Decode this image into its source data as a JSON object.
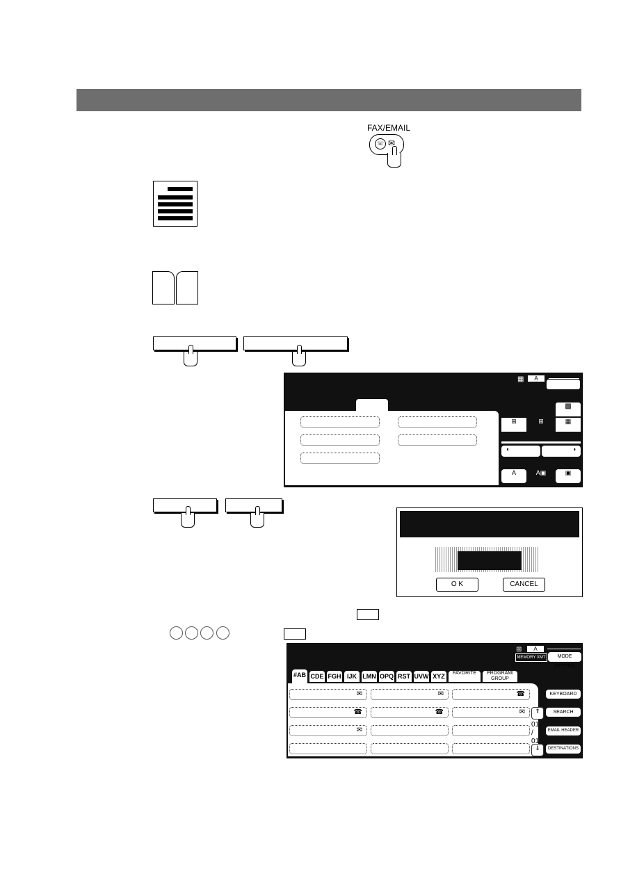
{
  "header": {
    "bar_color": "#6e6e6e"
  },
  "fax_email_key": {
    "label": "FAX/EMAIL",
    "icons": [
      "fax-icon",
      "envelope-icon",
      "hand-pointer-icon"
    ]
  },
  "illustrations": [
    "document-icon",
    "book-icon"
  ],
  "panel1": {
    "tabs": [
      "",
      "",
      "",
      "",
      "",
      ""
    ],
    "active_tab_index": 2,
    "resolution_icons": [
      "standard-grid-icon",
      "fine-grid-icon",
      "superfine-grid-icon"
    ],
    "contrast_icons": [
      "lighter-icon",
      "darker-icon"
    ],
    "original_icons": [
      "text-icon",
      "text-photo-icon",
      "photo-icon"
    ]
  },
  "dialog": {
    "ok_label": "O K",
    "cancel_label": "CANCEL"
  },
  "panel2": {
    "memory_xmt_label": "MEMORY XMT",
    "mode_setting_label": "MODE SETTING",
    "tabs": [
      "#AB",
      "CDE",
      "FGH",
      "IJK",
      "LMN",
      "OPQ",
      "RST",
      "UVW",
      "XYZ",
      "FAVORITE",
      "PROGRAM/ GROUP"
    ],
    "active_tab_index": 0,
    "entries": [
      {
        "icon": "envelope-icon"
      },
      {
        "icon": "envelope-icon"
      },
      {
        "icon": "telephone-icon"
      },
      {
        "icon": "telephone-icon"
      },
      {
        "icon": "telephone-icon"
      },
      {
        "icon": "envelope-icon"
      },
      {
        "icon": "envelope-icon"
      },
      {
        "icon": ""
      },
      {
        "icon": ""
      },
      {
        "icon": ""
      },
      {
        "icon": ""
      },
      {
        "icon": ""
      }
    ],
    "page_current": "01",
    "page_total": "01",
    "side_buttons": [
      "KEYBOARD",
      "SEARCH",
      "EMAIL HEADER",
      "DESTINATIONS"
    ]
  }
}
